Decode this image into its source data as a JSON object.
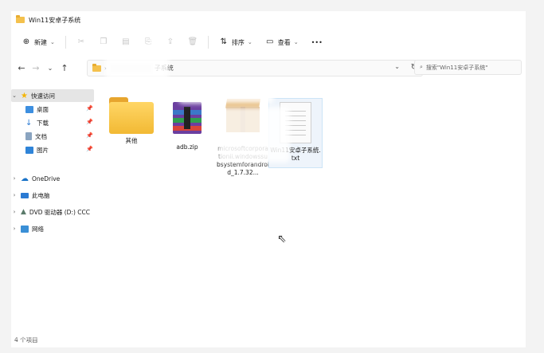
{
  "window": {
    "title": "Win11安卓子系统"
  },
  "toolbar": {
    "new_label": "新建",
    "sort_label": "排序",
    "view_label": "查看",
    "more_label": "•••"
  },
  "address": {
    "path_tail": "子系统",
    "search_placeholder": "搜索\"Win11安卓子系统\""
  },
  "sidebar": {
    "quick_access": "快速访问",
    "items": [
      {
        "label": "桌面"
      },
      {
        "label": "下载"
      },
      {
        "label": "文档"
      },
      {
        "label": "图片"
      }
    ],
    "onedrive": "OneDrive",
    "this_pc": "此电脑",
    "dvd": "DVD 驱动器 (D:) CCC",
    "network": "网络"
  },
  "files": [
    {
      "name": "其他",
      "type": "folder"
    },
    {
      "name": "adb.zip",
      "type": "zip"
    },
    {
      "name": "microsoftcorporationii.windowssubsystemforandroid_1.7.32...",
      "type": "package"
    },
    {
      "name": "Win11安卓子系统.txt",
      "type": "text"
    }
  ],
  "status": {
    "count": "4 个项目"
  },
  "colors": {
    "folder": "#f4c14d",
    "selected_bg": "#eef4fb",
    "quick_access_star": "#f4b400"
  }
}
